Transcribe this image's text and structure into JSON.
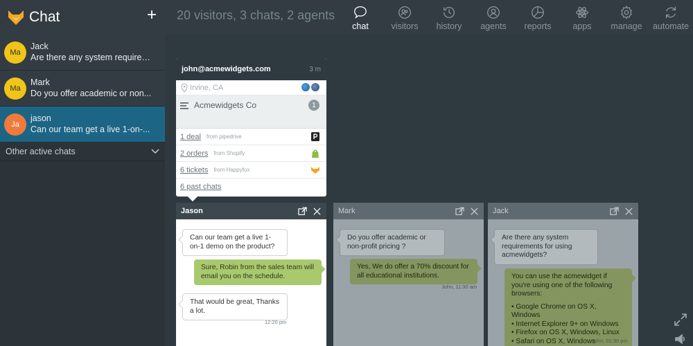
{
  "sidebar": {
    "title": "Chat",
    "add_label": "+",
    "chats": [
      {
        "initials": "Ma",
        "name": "Jack",
        "preview": "Are there any system requirem...",
        "avatar_color": "#f0c419",
        "avatar_text_color": "#333333"
      },
      {
        "initials": "Ma",
        "name": "Mark",
        "preview": "Do you offer academic or non...",
        "avatar_color": "#f0c419",
        "avatar_text_color": "#333333"
      },
      {
        "initials": "Ja",
        "name": "jason",
        "preview": "Can our team get a live 1-on-...",
        "avatar_color": "#f07a3c",
        "avatar_text_color": "#ffffff"
      }
    ],
    "other_chats_label": "Other active chats"
  },
  "topbar": {
    "stats": "20 visitors, 3 chats, 2 agents",
    "nav": [
      {
        "label": "chat",
        "icon": "chat-bubble-icon",
        "active": true
      },
      {
        "label": "visitors",
        "icon": "visitors-icon"
      },
      {
        "label": "history",
        "icon": "history-icon"
      },
      {
        "label": "agents",
        "icon": "agents-icon"
      },
      {
        "label": "reports",
        "icon": "reports-icon"
      },
      {
        "label": "apps",
        "icon": "apps-icon"
      },
      {
        "label": "manage",
        "icon": "gear-icon"
      },
      {
        "label": "automate",
        "icon": "automate-icon"
      }
    ]
  },
  "visitor_card": {
    "email": "john@acmewidgets.com",
    "time": "3 m",
    "location": "Irvine, CA",
    "company": "Acmewidgets Co",
    "company_count": "1",
    "integrations": [
      {
        "link": "1 deal",
        "from": "from pipedrive",
        "icon": "pipedrive-icon"
      },
      {
        "link": "2 orders",
        "from": "from Shopify",
        "icon": "shopify-icon"
      },
      {
        "link": "6 tickets",
        "from": "from Happyfox",
        "icon": "happyfox-icon"
      }
    ],
    "past_chats": "6 past chats"
  },
  "chat_windows": [
    {
      "name": "Jason",
      "messages": [
        {
          "text": "Can our team get a live 1-on-1 demo on the product?"
        },
        {
          "text": "Sure, Robin from the sales team will email you on the schedule."
        },
        {
          "text": "That would be great, Thanks a lot."
        }
      ],
      "timestamp": "12:20 pm"
    },
    {
      "name": "Mark",
      "messages": [
        {
          "text": "Do you offer academic or non-profit pricing ?"
        },
        {
          "text": "Yes, We do offer a 70% discount for all educational institutions."
        }
      ],
      "timestamp": "John, 11:30 am"
    },
    {
      "name": "Jack",
      "messages": [
        {
          "text": "Are there any system requirements for using acmewidgets?"
        },
        {
          "text": "You can use the acmewidget if you're using one of the following browsers:"
        }
      ],
      "browsers": [
        "• Google Chrome on OS X, Windows",
        "• Internet Explorer 9+ on Windows",
        "• Firefox on OS X, Windows, Linux",
        "• Safari on OS X, Windows"
      ],
      "timestamp": "John, 01:30 pm"
    }
  ],
  "colors": {
    "accent_active_chat": "#1d6585",
    "agent_bubble": "#a9c96e",
    "sidebar_bg": "#2c3439",
    "main_bg": "#2f3a40"
  }
}
